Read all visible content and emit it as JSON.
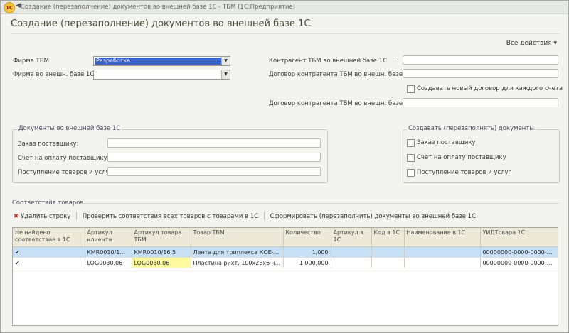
{
  "window": {
    "title": "Создание (перезаполнение) документов во внешней базе 1С - ТБМ  (1С:Предприятие)",
    "logo": "1C",
    "separator": "◀"
  },
  "heading": "Создание (перезаполнение) документов во внешней базе 1С",
  "all_actions": "Все действия ▾",
  "form": {
    "firma_tbm_label": "Фирма ТБМ:",
    "firma_tbm_value": "Разработка",
    "firma_ext_label": "Фирма во внешн. базе 1С:",
    "firma_ext_value": "",
    "kontragent_label": "Контрагент ТБМ во внешней базе 1С",
    "kontragent_colon": ":",
    "dogovor_label": "Договор контрагента ТБМ во внешн. базе:",
    "create_new_dogovor_label": "Создавать новый договор для каждого счета",
    "create_new_dogovor_checked": false,
    "dogovor2_label": "Договор контрагента ТБМ во внешн. базе:"
  },
  "docs_group": {
    "title": "Документы во внешней базе 1С",
    "zakaz_label": "Заказ поставщику:",
    "schet_label": "Счет на оплату поставщику :",
    "postuplenie_label": "Поступление товаров и услуг:"
  },
  "create_group": {
    "title": "Создавать (перезаполнять) документы",
    "items": [
      {
        "label": "Заказ поставщику",
        "checked": false
      },
      {
        "label": "Счет на оплату поставщику",
        "checked": false
      },
      {
        "label": "Поступление товаров и услуг",
        "checked": false
      }
    ]
  },
  "goods": {
    "section_title": "Соответствия товаров",
    "toolbar": {
      "delete_row": "Удалить строку",
      "check_all": "Проверить соответствия всех товаров с товарами в 1С",
      "form_docs": "Сформировать (перезаполнить) документы во внешней базе 1С"
    },
    "columns": [
      "Не найдено соответствие в 1С",
      "Артикул клиента",
      "Артикул товара ТБМ",
      "Товар ТБМ",
      "Количество",
      "Артикул в 1С",
      "Код в 1С",
      "Наименование в 1С",
      "УИДТовара 1С"
    ],
    "rows": [
      [
        "✔",
        "KMR0010/1...",
        "KMR0010/16.5",
        "Лента для триплекса КОЕ-...",
        "1,000",
        "",
        "",
        "",
        "00000000-0000-0000-0..."
      ],
      [
        "✔",
        "LOG0030.06",
        "LOG0030.06",
        "Пластина рихт. 100х28х6 ч...",
        "1 000,000",
        "",
        "",
        "",
        "00000000-0000-0000-0..."
      ]
    ]
  }
}
